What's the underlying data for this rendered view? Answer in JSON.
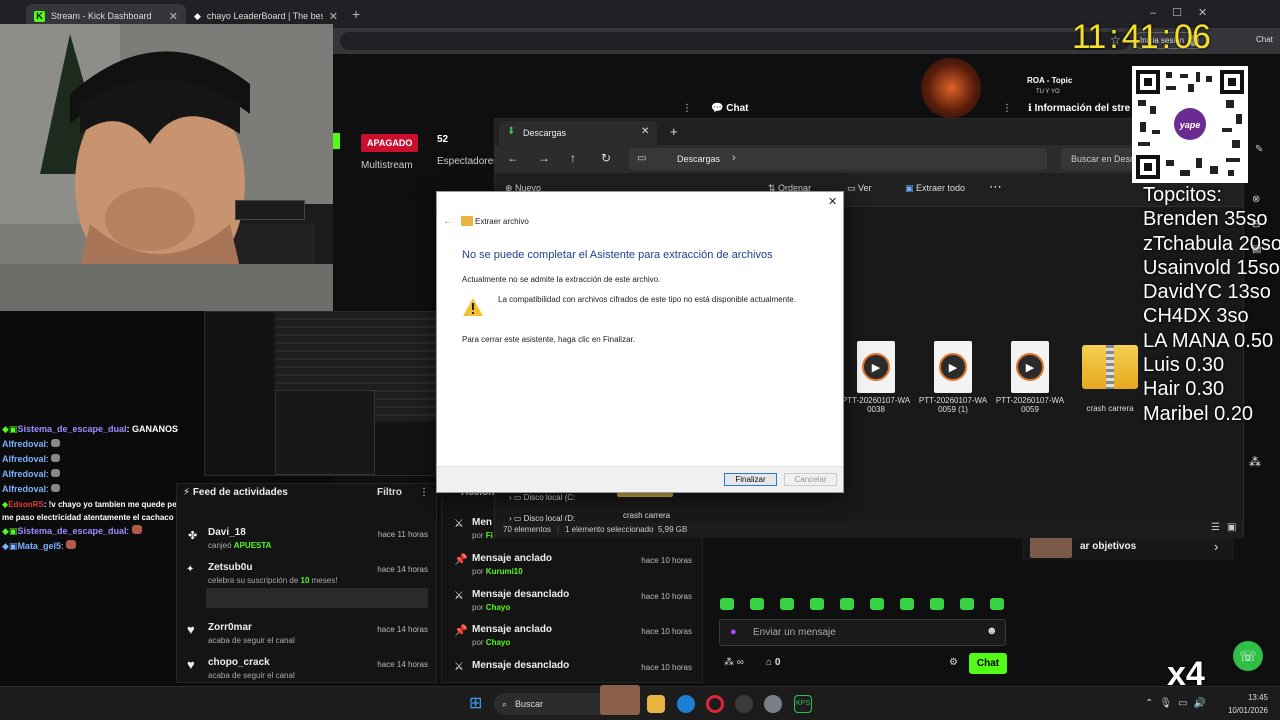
{
  "browser": {
    "tabs": [
      {
        "label": "Stream - Kick Dashboard",
        "active": true
      },
      {
        "label": "chayo LeaderBoard | The best Cha",
        "active": false
      }
    ],
    "profile_label": "Inicia sesión",
    "chat_short": "Chat"
  },
  "clock": {
    "h": "11",
    "m": "41",
    "s": "06"
  },
  "kick": {
    "status_label": "APAGADO",
    "multistream_label": "Multistream",
    "viewers_count": "52",
    "viewers_label": "Espectadores",
    "chat_header": "Chat",
    "info_header": "Información del stre",
    "song_title": "ROA - Topic",
    "song_artist": "TU Y YO",
    "feed": {
      "title": "Feed de actividades",
      "filter": "Filtro",
      "items": [
        {
          "name": "Davi_18",
          "sub_prefix": "canjeó ",
          "sub_highlight": "APUESTA",
          "time": "hace 11 horas",
          "icon": "gift-icon"
        },
        {
          "name": "Zetsub0u",
          "sub_prefix": "celebra su suscripción de ",
          "sub_highlight": "10",
          "sub_suffix": " meses!",
          "time": "hace 14 horas",
          "icon": "star-icon"
        },
        {
          "name": "Zorr0mar",
          "sub_prefix": "acaba de seguir el canal",
          "time": "hace 14 horas",
          "icon": "heart-icon"
        },
        {
          "name": "chopo_crack",
          "sub_prefix": "acaba de seguir el canal",
          "time": "hace 14 horas",
          "icon": "heart-icon"
        }
      ]
    },
    "actions": {
      "title": "Accion",
      "items": [
        {
          "title": "Men",
          "by_prefix": "por ",
          "by": "Fi",
          "time": ""
        },
        {
          "title": "Mensaje anclado",
          "by_prefix": "por ",
          "by": "Kurumi10",
          "time": "hace 10 horas"
        },
        {
          "title": "Mensaje desanclado",
          "by_prefix": "por ",
          "by": "Chayo",
          "time": "hace 10 horas"
        },
        {
          "title": "Mensaje anclado",
          "by_prefix": "por ",
          "by": "Chayo",
          "time": "hace 10 horas"
        },
        {
          "title": "Mensaje desanclado",
          "by_prefix": "por ",
          "by": "",
          "time": "hace 10 horas"
        }
      ]
    },
    "chat_input_placeholder": "Enviar un mensaje",
    "chat_send": "Chat",
    "points_count": "0",
    "goals_label": "ar objetivos"
  },
  "chat_overlay": [
    {
      "user": "Sistema_de_escape_dual",
      "color": "#9b8cff",
      "text": ": GANANOS"
    },
    {
      "user": "Alfredoval",
      "color": "#7ab0ff",
      "text": ":"
    },
    {
      "user": "Alfredoval",
      "color": "#7ab0ff",
      "text": ":"
    },
    {
      "user": "Alfredoval",
      "color": "#7ab0ff",
      "text": ":"
    },
    {
      "user": "Alfredoval",
      "color": "#7ab0ff",
      "text": ":"
    },
    {
      "user": "EdsonRS",
      "color": "#e23a3a",
      "text": ": !v chayo yo tambien me quede pegado pero a camila y eso que no"
    },
    {
      "user": "",
      "color": "#ffffff",
      "text": "me paso electricidad atentamente el cachaco"
    },
    {
      "user": "Sistema_de_escape_dual",
      "color": "#9b8cff",
      "text": ":"
    },
    {
      "user": "Mata_gel5",
      "color": "#7ab0ff",
      "text": ":"
    }
  ],
  "explorer": {
    "tab_title": "Descargas",
    "path": "Descargas",
    "search_placeholder": "Buscar en Desc",
    "toolbar": {
      "new": "Nuevo",
      "sort": "Ordenar",
      "view": "Ver",
      "extract_all": "Extraer todo"
    },
    "files": [
      {
        "name": "PTT-20260107-WA0038",
        "type": "video"
      },
      {
        "name": "PTT-20260107-WA0059 (1)",
        "type": "video"
      },
      {
        "name": "PTT-20260107-WA0059",
        "type": "video"
      },
      {
        "name": "crash carrera",
        "type": "zip"
      }
    ],
    "nav": [
      {
        "label": "Disco local (C:"
      },
      {
        "label": "Disco local (D:"
      }
    ],
    "folder_under": "crash carrera",
    "status": {
      "count": "70 elementos",
      "selected": "1 elemento seleccionado  5,99 GB"
    }
  },
  "dialog": {
    "title": "Extraer archivo",
    "heading": "No se puede completar el Asistente para extracción de archivos",
    "line1": "Actualmente no se admite la extracción de este archivo.",
    "warning": "La compatibilidad con archivos cifrados de este tipo no está disponible actualmente.",
    "line2": "Para cerrar este asistente, haga clic en Finalizar.",
    "finish": "Finalizar",
    "cancel": "Cancelar"
  },
  "topcitos": {
    "title": "Topcitos:",
    "entries": [
      "Brenden 35so",
      "zTchabula 20so",
      "Usainvold 15so",
      "DavidYC 13so",
      "CH4DX 3so",
      "LA MANA 0.50",
      "Luis 0.30",
      "Hair 0.30",
      "Maribel 0.20"
    ]
  },
  "qr": {
    "brand": "yape"
  },
  "taskbar": {
    "search": "Buscar",
    "time": "13:45",
    "date": "10/01/2026"
  },
  "overlay_x4": "x4"
}
